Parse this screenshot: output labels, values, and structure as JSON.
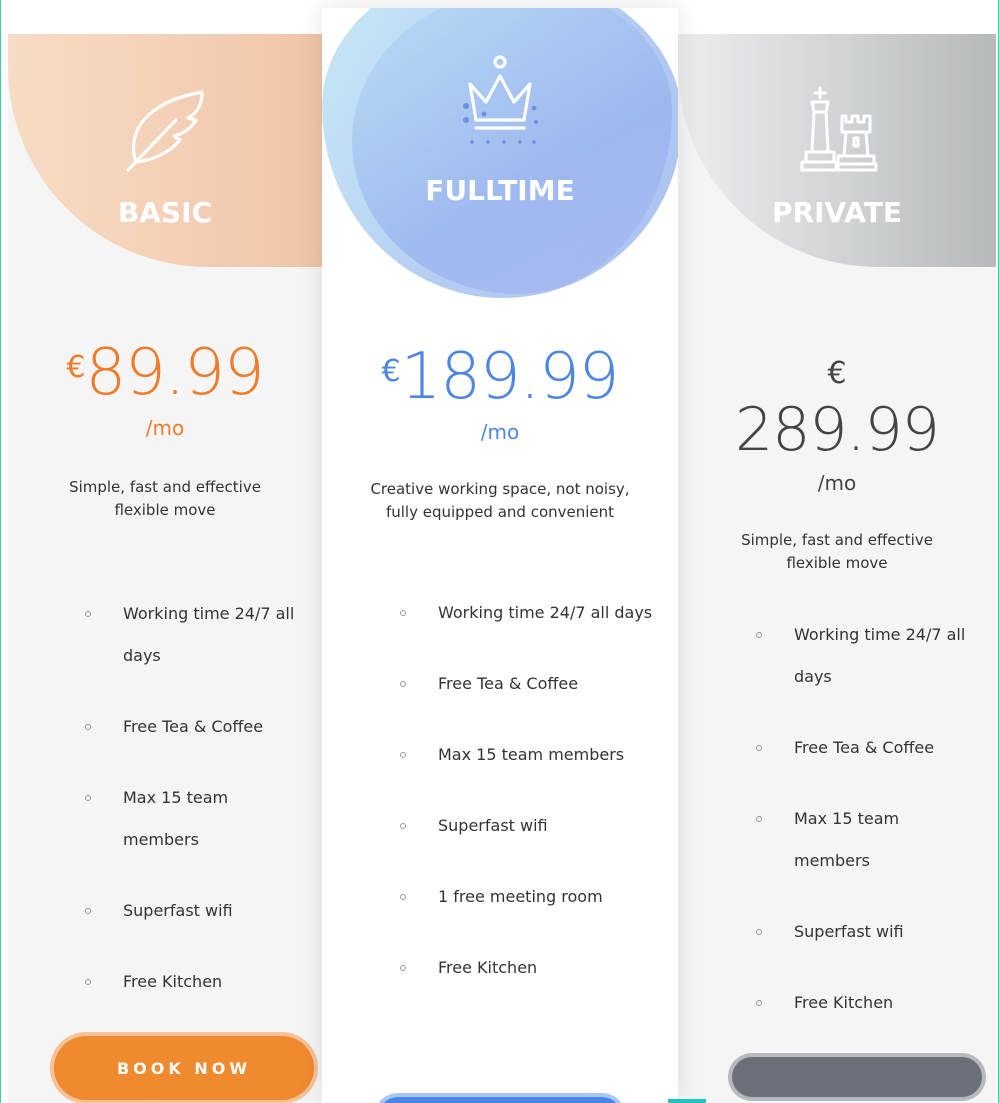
{
  "plans": [
    {
      "name": "BASIC",
      "currency": "€",
      "amount": "89.99",
      "period": "/mo",
      "description": "Simple, fast and effective flexible move",
      "features": [
        "Working time 24/7 all days",
        "Free Tea & Coffee",
        "Max 15 team members",
        "Superfast wifi",
        "Free Kitchen"
      ],
      "button_label": "BOOK NOW",
      "icon": "feather-icon",
      "accent": "#f07b2b"
    },
    {
      "name": "FULLTIME",
      "currency": "€",
      "amount": "189.99",
      "period": "/mo",
      "description": "Creative working space, not noisy, fully equipped and convenient",
      "features": [
        "Working time 24/7 all days",
        "Free Tea & Coffee",
        "Max 15 team members",
        "Superfast wifi",
        "1 free meeting room",
        "Free Kitchen"
      ],
      "icon": "crown-icon",
      "accent": "#4e86e3"
    },
    {
      "name": "PRIVATE",
      "currency": "€",
      "amount": "289.99",
      "period": "/mo",
      "description": "Simple, fast and effective flexible move",
      "features": [
        "Working time 24/7 all days",
        "Free Tea & Coffee",
        "Max 15 team members",
        "Superfast wifi",
        "Free Kitchen"
      ],
      "icon": "chess-pieces-icon",
      "accent": "#6b6f78"
    }
  ]
}
